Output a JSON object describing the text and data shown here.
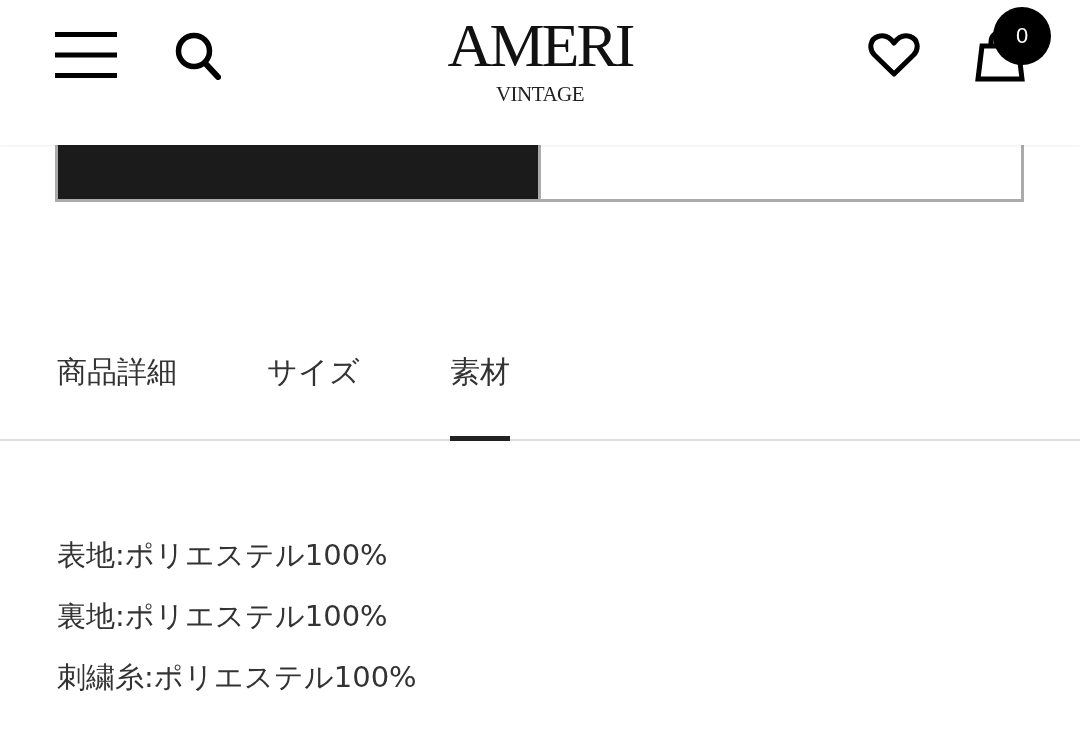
{
  "header": {
    "logo": {
      "title": "AMERI",
      "subtitle": "VINTAGE"
    },
    "cart": {
      "count": "0"
    }
  },
  "size_buttons": [
    {
      "selected": true
    },
    {
      "selected": false
    }
  ],
  "tabs": [
    {
      "label": "商品詳細",
      "selected": false
    },
    {
      "label": "サイズ",
      "selected": false
    },
    {
      "label": "素材",
      "selected": true
    }
  ],
  "materials": [
    "表地:ポリエステル100%",
    "裏地:ポリエステル100%",
    "刺繍糸:ポリエステル100%"
  ]
}
